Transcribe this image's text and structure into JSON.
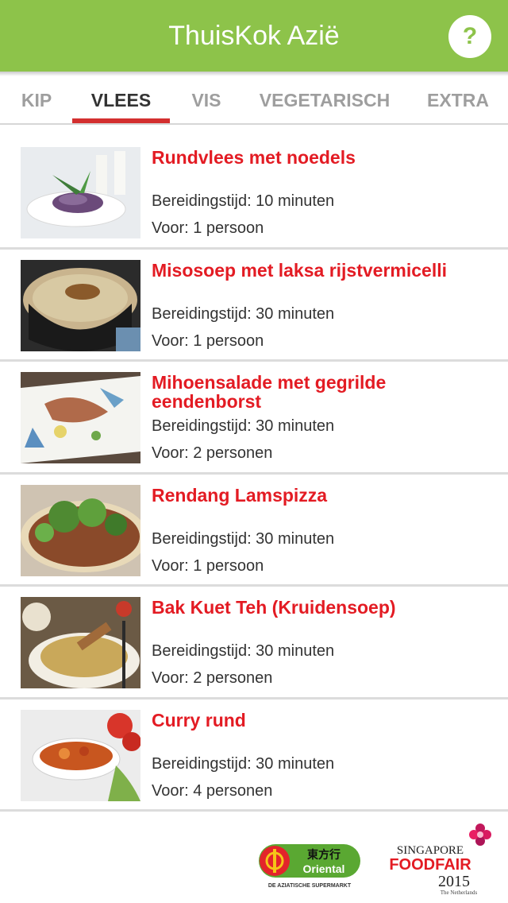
{
  "app": {
    "title": "ThuisKok Azië",
    "help_label": "?"
  },
  "tabs": [
    {
      "label": "KIP"
    },
    {
      "label": "VLEES"
    },
    {
      "label": "VIS"
    },
    {
      "label": "VEGETARISCH"
    },
    {
      "label": "EXTRA"
    }
  ],
  "active_tab": "VLEES",
  "recipes": [
    {
      "title": "Rundvlees met noedels",
      "time": "Bereidingstijd: 10 minuten",
      "servings": "Voor: 1 persoon"
    },
    {
      "title": "Misosoep met laksa rijstvermicelli",
      "time": "Bereidingstijd: 30 minuten",
      "servings": "Voor: 1 persoon"
    },
    {
      "title": "Mihoensalade met gegrilde eendenborst",
      "time": "Bereidingstijd: 30 minuten",
      "servings": "Voor: 2 personen"
    },
    {
      "title": "Rendang Lamspizza",
      "time": "Bereidingstijd: 30 minuten",
      "servings": "Voor: 1 persoon"
    },
    {
      "title": "Bak Kuet Teh (Kruidensoep)",
      "time": "Bereidingstijd: 30 minuten",
      "servings": "Voor: 2 personen"
    },
    {
      "title": "Curry rund",
      "time": "Bereidingstijd: 30 minuten",
      "servings": "Voor: 4 personen"
    }
  ],
  "footer": {
    "oriental": {
      "chinese": "東方行",
      "brand": "Oriental",
      "tagline": "DE AZIATISCHE SUPERMARKT"
    },
    "foodfair": {
      "line1": "SINGAPORE",
      "line2": "FOODFAIR",
      "year": "2015",
      "sub": "The Netherlands"
    }
  },
  "colors": {
    "appbar": "#8dc34a",
    "accent": "#e31b23",
    "indicator": "#d32f2f"
  }
}
